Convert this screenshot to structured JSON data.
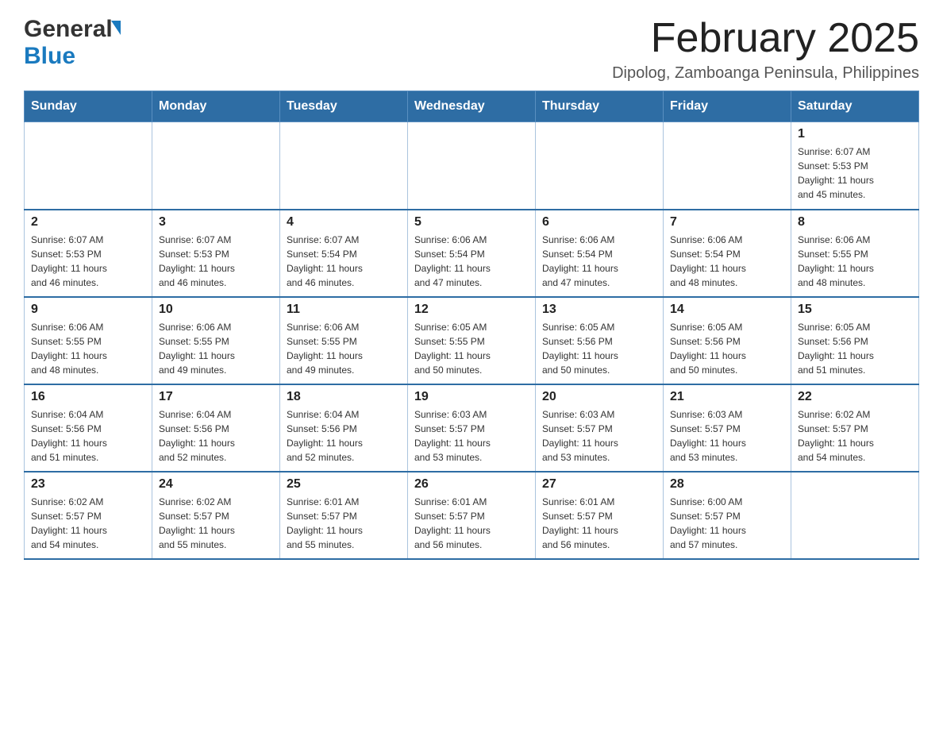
{
  "header": {
    "logo_general": "General",
    "logo_blue": "Blue",
    "main_title": "February 2025",
    "subtitle": "Dipolog, Zamboanga Peninsula, Philippines"
  },
  "calendar": {
    "days_of_week": [
      "Sunday",
      "Monday",
      "Tuesday",
      "Wednesday",
      "Thursday",
      "Friday",
      "Saturday"
    ],
    "weeks": [
      [
        {
          "day": "",
          "info": ""
        },
        {
          "day": "",
          "info": ""
        },
        {
          "day": "",
          "info": ""
        },
        {
          "day": "",
          "info": ""
        },
        {
          "day": "",
          "info": ""
        },
        {
          "day": "",
          "info": ""
        },
        {
          "day": "1",
          "info": "Sunrise: 6:07 AM\nSunset: 5:53 PM\nDaylight: 11 hours\nand 45 minutes."
        }
      ],
      [
        {
          "day": "2",
          "info": "Sunrise: 6:07 AM\nSunset: 5:53 PM\nDaylight: 11 hours\nand 46 minutes."
        },
        {
          "day": "3",
          "info": "Sunrise: 6:07 AM\nSunset: 5:53 PM\nDaylight: 11 hours\nand 46 minutes."
        },
        {
          "day": "4",
          "info": "Sunrise: 6:07 AM\nSunset: 5:54 PM\nDaylight: 11 hours\nand 46 minutes."
        },
        {
          "day": "5",
          "info": "Sunrise: 6:06 AM\nSunset: 5:54 PM\nDaylight: 11 hours\nand 47 minutes."
        },
        {
          "day": "6",
          "info": "Sunrise: 6:06 AM\nSunset: 5:54 PM\nDaylight: 11 hours\nand 47 minutes."
        },
        {
          "day": "7",
          "info": "Sunrise: 6:06 AM\nSunset: 5:54 PM\nDaylight: 11 hours\nand 48 minutes."
        },
        {
          "day": "8",
          "info": "Sunrise: 6:06 AM\nSunset: 5:55 PM\nDaylight: 11 hours\nand 48 minutes."
        }
      ],
      [
        {
          "day": "9",
          "info": "Sunrise: 6:06 AM\nSunset: 5:55 PM\nDaylight: 11 hours\nand 48 minutes."
        },
        {
          "day": "10",
          "info": "Sunrise: 6:06 AM\nSunset: 5:55 PM\nDaylight: 11 hours\nand 49 minutes."
        },
        {
          "day": "11",
          "info": "Sunrise: 6:06 AM\nSunset: 5:55 PM\nDaylight: 11 hours\nand 49 minutes."
        },
        {
          "day": "12",
          "info": "Sunrise: 6:05 AM\nSunset: 5:55 PM\nDaylight: 11 hours\nand 50 minutes."
        },
        {
          "day": "13",
          "info": "Sunrise: 6:05 AM\nSunset: 5:56 PM\nDaylight: 11 hours\nand 50 minutes."
        },
        {
          "day": "14",
          "info": "Sunrise: 6:05 AM\nSunset: 5:56 PM\nDaylight: 11 hours\nand 50 minutes."
        },
        {
          "day": "15",
          "info": "Sunrise: 6:05 AM\nSunset: 5:56 PM\nDaylight: 11 hours\nand 51 minutes."
        }
      ],
      [
        {
          "day": "16",
          "info": "Sunrise: 6:04 AM\nSunset: 5:56 PM\nDaylight: 11 hours\nand 51 minutes."
        },
        {
          "day": "17",
          "info": "Sunrise: 6:04 AM\nSunset: 5:56 PM\nDaylight: 11 hours\nand 52 minutes."
        },
        {
          "day": "18",
          "info": "Sunrise: 6:04 AM\nSunset: 5:56 PM\nDaylight: 11 hours\nand 52 minutes."
        },
        {
          "day": "19",
          "info": "Sunrise: 6:03 AM\nSunset: 5:57 PM\nDaylight: 11 hours\nand 53 minutes."
        },
        {
          "day": "20",
          "info": "Sunrise: 6:03 AM\nSunset: 5:57 PM\nDaylight: 11 hours\nand 53 minutes."
        },
        {
          "day": "21",
          "info": "Sunrise: 6:03 AM\nSunset: 5:57 PM\nDaylight: 11 hours\nand 53 minutes."
        },
        {
          "day": "22",
          "info": "Sunrise: 6:02 AM\nSunset: 5:57 PM\nDaylight: 11 hours\nand 54 minutes."
        }
      ],
      [
        {
          "day": "23",
          "info": "Sunrise: 6:02 AM\nSunset: 5:57 PM\nDaylight: 11 hours\nand 54 minutes."
        },
        {
          "day": "24",
          "info": "Sunrise: 6:02 AM\nSunset: 5:57 PM\nDaylight: 11 hours\nand 55 minutes."
        },
        {
          "day": "25",
          "info": "Sunrise: 6:01 AM\nSunset: 5:57 PM\nDaylight: 11 hours\nand 55 minutes."
        },
        {
          "day": "26",
          "info": "Sunrise: 6:01 AM\nSunset: 5:57 PM\nDaylight: 11 hours\nand 56 minutes."
        },
        {
          "day": "27",
          "info": "Sunrise: 6:01 AM\nSunset: 5:57 PM\nDaylight: 11 hours\nand 56 minutes."
        },
        {
          "day": "28",
          "info": "Sunrise: 6:00 AM\nSunset: 5:57 PM\nDaylight: 11 hours\nand 57 minutes."
        },
        {
          "day": "",
          "info": ""
        }
      ]
    ]
  }
}
